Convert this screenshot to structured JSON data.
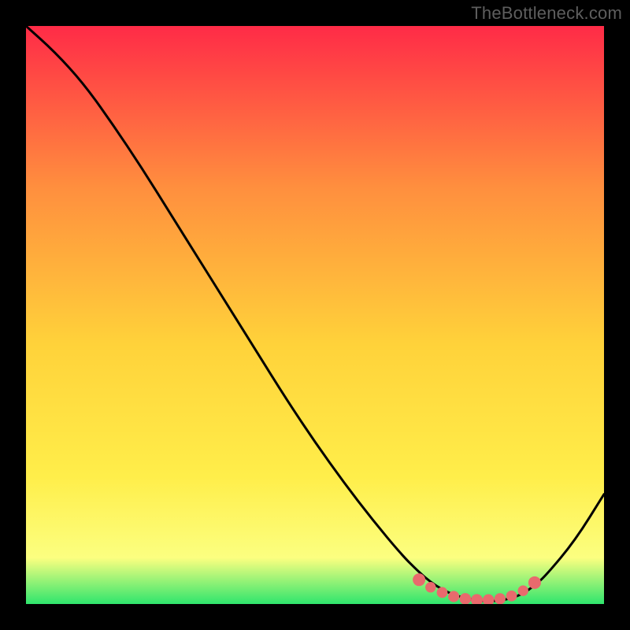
{
  "watermark": "TheBottleneck.com",
  "colors": {
    "background": "#000000",
    "gradient_top": "#ff2b47",
    "gradient_mid_upper": "#ff8f3e",
    "gradient_mid": "#ffd23a",
    "gradient_mid_lower": "#ffee4a",
    "gradient_lower": "#fcff80",
    "gradient_bottom": "#2fe56d",
    "curve": "#000000",
    "dots": "#e86a6d"
  },
  "chart_data": {
    "type": "line",
    "title": "",
    "xlabel": "",
    "ylabel": "",
    "xlim": [
      0,
      100
    ],
    "ylim": [
      0,
      100
    ],
    "series": [
      {
        "name": "bottleneck-curve",
        "x": [
          0,
          5,
          10,
          15,
          20,
          25,
          30,
          35,
          40,
          45,
          50,
          55,
          60,
          65,
          68,
          70,
          72,
          74,
          76,
          78,
          80,
          82,
          84,
          86,
          88,
          90,
          95,
          100
        ],
        "y": [
          100,
          95.5,
          90,
          83,
          75.5,
          67.5,
          59.5,
          51.5,
          43.5,
          35.5,
          28,
          21,
          14.5,
          8.5,
          5.5,
          3.8,
          2.5,
          1.6,
          1.0,
          0.6,
          0.5,
          0.6,
          1.0,
          1.8,
          3.2,
          5.0,
          11,
          19
        ]
      }
    ],
    "optimal_points": {
      "name": "optimal-zone-dots",
      "x": [
        68,
        70,
        72,
        74,
        76,
        78,
        80,
        82,
        84,
        86,
        88
      ],
      "y": [
        4.2,
        2.9,
        2.0,
        1.3,
        0.9,
        0.7,
        0.7,
        0.9,
        1.4,
        2.3,
        3.7
      ]
    }
  }
}
